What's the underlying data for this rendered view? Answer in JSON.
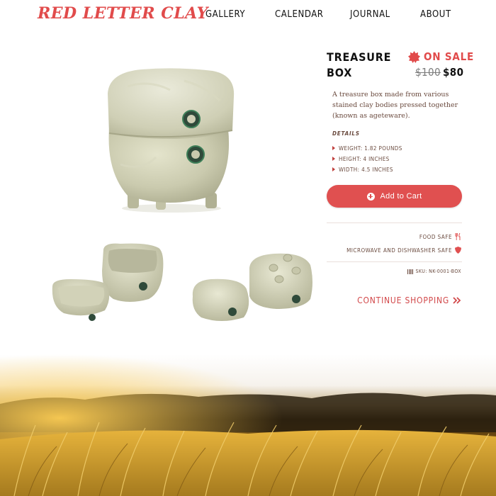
{
  "header": {
    "logo": "RED LETTER CLAY",
    "nav": [
      "GALLERY",
      "CALENDAR",
      "JOURNAL",
      "ABOUT"
    ]
  },
  "product": {
    "title": "TREASURE BOX",
    "sale_label": "ON SALE",
    "price_old": "$100",
    "price_new": "$80",
    "description": "A treasure box made from various stained clay bodies pressed together (known as ageteware).",
    "details_heading": "DETAILS",
    "details": [
      "WEIGHT: 1.82 POUNDS",
      "HEIGHT: 4 INCHES",
      "WIDTH: 4.5 INCHES"
    ],
    "add_to_cart": "Add to Cart",
    "features": [
      "FOOD SAFE",
      "MICROWAVE AND DISHWASHER SAFE"
    ],
    "sku": "SKU: NK-0001-BOX",
    "continue_shopping": "CONTINUE SHOPPING"
  },
  "colors": {
    "brand_red": "#e14b4b",
    "text_brown": "#6a4a3e",
    "clay_green": "#c9c9ad"
  },
  "icons": {
    "sale": "starburst-icon",
    "add": "plus-circle-icon",
    "food_safe": "fork-knife-icon",
    "microwave": "shield-icon",
    "sku": "barcode-icon",
    "continue": "double-chevron-right-icon"
  }
}
